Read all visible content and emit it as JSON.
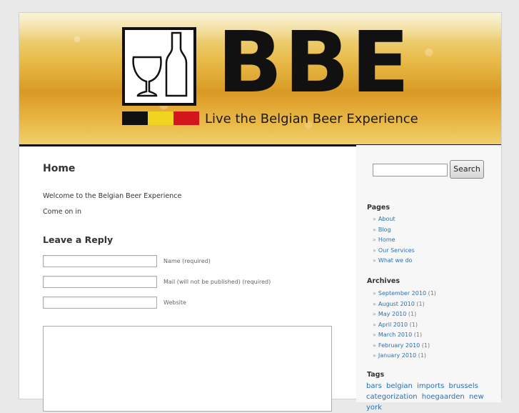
{
  "header": {
    "logo_letters": "BBE",
    "tagline": "Live the Belgian Beer Experience",
    "flag_colors": [
      "#111111",
      "#f2d320",
      "#d4161c"
    ]
  },
  "content": {
    "page_title": "Home",
    "paragraph1": "Welcome to the Belgian Beer Experience",
    "paragraph2": "Come on in",
    "reply_heading": "Leave a Reply",
    "fields": {
      "name_label": "Name (required)",
      "mail_label": "Mail (will not be published) (required)",
      "website_label": "Website"
    }
  },
  "sidebar": {
    "search_button": "Search",
    "pages_title": "Pages",
    "pages": [
      "About",
      "Blog",
      "Home",
      "Our Services",
      "What we do"
    ],
    "archives_title": "Archives",
    "archives": [
      {
        "label": "September 2010",
        "count": "(1)"
      },
      {
        "label": "August 2010",
        "count": "(1)"
      },
      {
        "label": "May 2010",
        "count": "(1)"
      },
      {
        "label": "April 2010",
        "count": "(1)"
      },
      {
        "label": "March 2010",
        "count": "(1)"
      },
      {
        "label": "February 2010",
        "count": "(1)"
      },
      {
        "label": "January 2010",
        "count": "(1)"
      }
    ],
    "tags_title": "Tags",
    "tags": [
      "bars",
      "belgian",
      "imports",
      "brussels",
      "categorization",
      "hoegaarden",
      "new york"
    ]
  },
  "colors": {
    "link": "#2b6fb6",
    "page_bg": "#e9e9e9"
  }
}
